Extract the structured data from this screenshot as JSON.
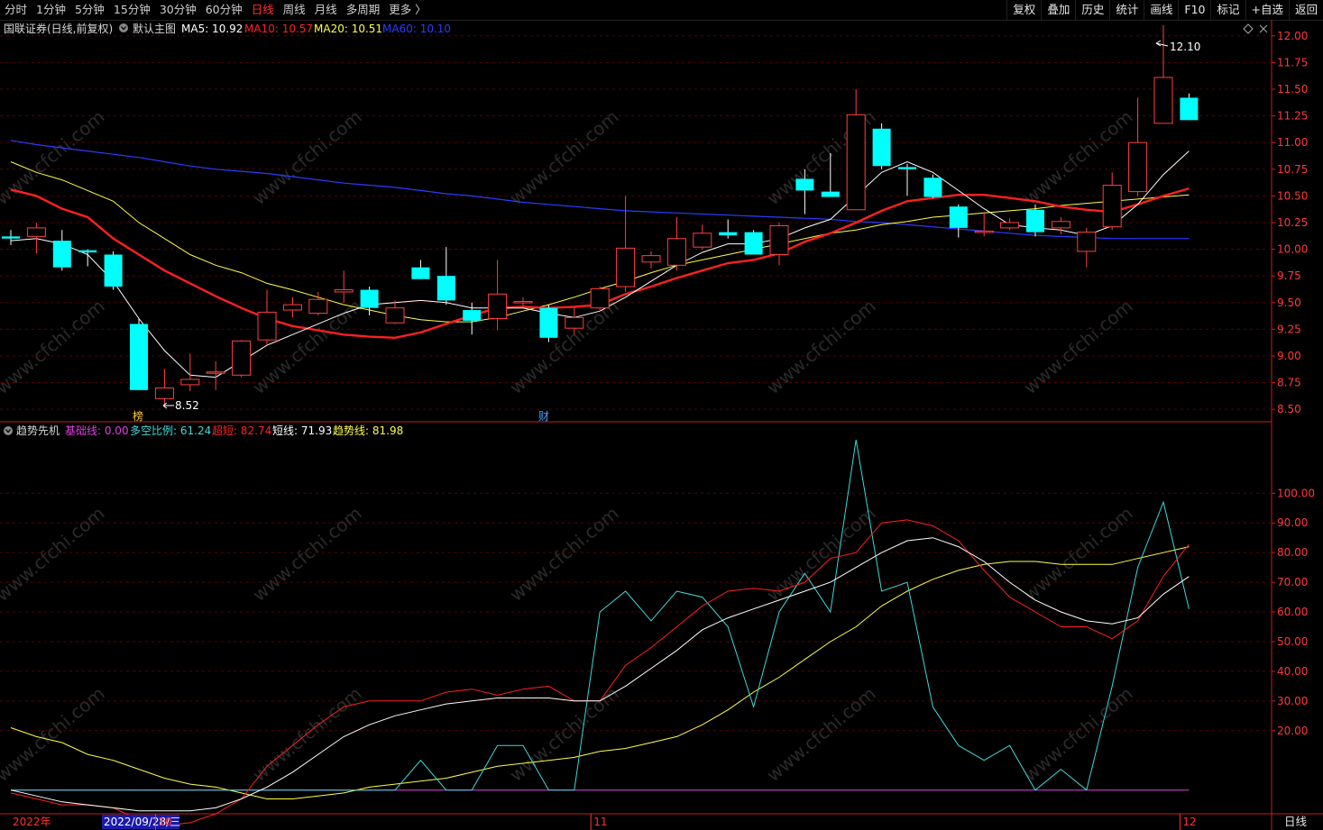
{
  "toolbar": {
    "periods": [
      "分时",
      "1分钟",
      "5分钟",
      "15分钟",
      "30分钟",
      "60分钟",
      "日线",
      "周线",
      "月线",
      "多周期",
      "更多 〉"
    ],
    "active_period": "日线",
    "actions": [
      "复权",
      "叠加",
      "历史",
      "统计",
      "画线",
      "F10",
      "标记",
      "+自选",
      "返回"
    ]
  },
  "main_legend": {
    "title": "国联证券(日线,前复权)",
    "indicator": "默认主图",
    "ma": [
      {
        "label": "MA5: 10.92",
        "color": "#ffffff"
      },
      {
        "label": "MA10: 10.57",
        "color": "#ff2020"
      },
      {
        "label": "MA20: 10.51",
        "color": "#ffff44"
      },
      {
        "label": "MA60: 10.10",
        "color": "#2a3cff"
      }
    ]
  },
  "sub_legend": {
    "title": "趋势先机",
    "items": [
      {
        "label": "基础线: 0.00",
        "color": "#e040e0"
      },
      {
        "label": "多空比例: 61.24",
        "color": "#40d8d8"
      },
      {
        "label": "超短: 82.74",
        "color": "#ff2020"
      },
      {
        "label": "短线: 71.93",
        "color": "#ffffff"
      },
      {
        "label": "趋势线: 81.98",
        "color": "#ffff44"
      }
    ]
  },
  "markers": {
    "high": "12.10",
    "low": "8.52",
    "bang": "榜",
    "cai": "财"
  },
  "watermark": "www.cfchi.com",
  "bottom_axis": {
    "year_label": "2022年",
    "cursor_date": "2022/09/28/三",
    "month_labels": [
      {
        "label": "10",
        "i": 6
      },
      {
        "label": "11",
        "i": 23
      },
      {
        "label": "12",
        "i": 46
      }
    ],
    "period_button": "日线"
  },
  "colors": {
    "up": "#ff4040",
    "down": "#00ffff",
    "grid": "#5a0000",
    "axis": "#c02020"
  },
  "chart_data": [
    {
      "type": "candlestick",
      "ylim": [
        8.4,
        12.15
      ],
      "y_ticks": [
        "12.00",
        "11.75",
        "11.50",
        "11.25",
        "11.00",
        "10.75",
        "10.50",
        "10.25",
        "10.00",
        "9.75",
        "9.50",
        "9.25",
        "9.00",
        "8.75",
        "8.50"
      ],
      "candles": [
        {
          "o": 10.12,
          "h": 10.18,
          "l": 10.04,
          "c": 10.1
        },
        {
          "o": 10.12,
          "h": 10.25,
          "l": 9.96,
          "c": 10.2
        },
        {
          "o": 10.08,
          "h": 10.18,
          "l": 9.8,
          "c": 9.83
        },
        {
          "o": 9.99,
          "h": 10.0,
          "l": 9.84,
          "c": 9.97
        },
        {
          "o": 9.95,
          "h": 9.98,
          "l": 9.62,
          "c": 9.65
        },
        {
          "o": 9.3,
          "h": 9.35,
          "l": 8.68,
          "c": 8.68
        },
        {
          "o": 8.6,
          "h": 8.88,
          "l": 8.52,
          "c": 8.7
        },
        {
          "o": 8.73,
          "h": 9.02,
          "l": 8.67,
          "c": 8.78
        },
        {
          "o": 8.85,
          "h": 8.95,
          "l": 8.68,
          "c": 8.85
        },
        {
          "o": 8.82,
          "h": 9.15,
          "l": 8.8,
          "c": 9.14
        },
        {
          "o": 9.15,
          "h": 9.62,
          "l": 9.1,
          "c": 9.41
        },
        {
          "o": 9.43,
          "h": 9.55,
          "l": 9.36,
          "c": 9.48
        },
        {
          "o": 9.4,
          "h": 9.6,
          "l": 9.38,
          "c": 9.53
        },
        {
          "o": 9.6,
          "h": 9.8,
          "l": 9.5,
          "c": 9.62
        },
        {
          "o": 9.62,
          "h": 9.65,
          "l": 9.38,
          "c": 9.45
        },
        {
          "o": 9.31,
          "h": 9.52,
          "l": 9.3,
          "c": 9.45
        },
        {
          "o": 9.83,
          "h": 9.9,
          "l": 9.72,
          "c": 9.72
        },
        {
          "o": 9.75,
          "h": 10.02,
          "l": 9.48,
          "c": 9.52
        },
        {
          "o": 9.43,
          "h": 9.5,
          "l": 9.2,
          "c": 9.33
        },
        {
          "o": 9.35,
          "h": 9.9,
          "l": 9.24,
          "c": 9.58
        },
        {
          "o": 9.5,
          "h": 9.55,
          "l": 9.46,
          "c": 9.51
        },
        {
          "o": 9.45,
          "h": 9.48,
          "l": 9.13,
          "c": 9.17
        },
        {
          "o": 9.26,
          "h": 9.45,
          "l": 9.2,
          "c": 9.36
        },
        {
          "o": 9.45,
          "h": 9.65,
          "l": 9.42,
          "c": 9.63
        },
        {
          "o": 9.65,
          "h": 10.5,
          "l": 9.6,
          "c": 10.01
        },
        {
          "o": 9.88,
          "h": 9.98,
          "l": 9.82,
          "c": 9.94
        },
        {
          "o": 9.85,
          "h": 10.3,
          "l": 9.8,
          "c": 10.1
        },
        {
          "o": 10.02,
          "h": 10.23,
          "l": 10.0,
          "c": 10.15
        },
        {
          "o": 10.16,
          "h": 10.28,
          "l": 10.1,
          "c": 10.13
        },
        {
          "o": 10.16,
          "h": 10.18,
          "l": 9.95,
          "c": 9.95
        },
        {
          "o": 9.95,
          "h": 10.25,
          "l": 9.85,
          "c": 10.22
        },
        {
          "o": 10.66,
          "h": 10.75,
          "l": 10.33,
          "c": 10.55
        },
        {
          "o": 10.54,
          "h": 10.9,
          "l": 10.5,
          "c": 10.49
        },
        {
          "o": 10.37,
          "h": 11.5,
          "l": 10.37,
          "c": 11.26
        },
        {
          "o": 11.13,
          "h": 11.18,
          "l": 10.75,
          "c": 10.78
        },
        {
          "o": 10.77,
          "h": 10.8,
          "l": 10.5,
          "c": 10.75
        },
        {
          "o": 10.67,
          "h": 10.7,
          "l": 10.48,
          "c": 10.49
        },
        {
          "o": 10.4,
          "h": 10.42,
          "l": 10.11,
          "c": 10.2
        },
        {
          "o": 10.17,
          "h": 10.35,
          "l": 10.12,
          "c": 10.17
        },
        {
          "o": 10.2,
          "h": 10.29,
          "l": 10.18,
          "c": 10.25
        },
        {
          "o": 10.37,
          "h": 10.42,
          "l": 10.12,
          "c": 10.16
        },
        {
          "o": 10.2,
          "h": 10.3,
          "l": 10.14,
          "c": 10.26
        },
        {
          "o": 9.98,
          "h": 10.2,
          "l": 9.83,
          "c": 10.16
        },
        {
          "o": 10.21,
          "h": 10.72,
          "l": 10.18,
          "c": 10.6
        },
        {
          "o": 10.54,
          "h": 11.42,
          "l": 10.5,
          "c": 11.0
        },
        {
          "o": 11.18,
          "h": 12.1,
          "l": 11.18,
          "c": 11.61
        },
        {
          "o": 11.42,
          "h": 11.46,
          "l": 11.21,
          "c": 11.21
        }
      ],
      "ma5": [
        10.08,
        10.1,
        10.05,
        9.95,
        9.7,
        9.35,
        9.05,
        8.82,
        8.8,
        8.95,
        9.1,
        9.2,
        9.3,
        9.4,
        9.48,
        9.5,
        9.52,
        9.5,
        9.45,
        9.45,
        9.45,
        9.4,
        9.36,
        9.42,
        9.55,
        9.7,
        9.85,
        9.97,
        10.05,
        10.05,
        10.1,
        10.2,
        10.28,
        10.5,
        10.72,
        10.82,
        10.72,
        10.55,
        10.38,
        10.23,
        10.2,
        10.18,
        10.13,
        10.22,
        10.42,
        10.7,
        10.92
      ],
      "ma10": [
        10.56,
        10.5,
        10.38,
        10.3,
        10.1,
        9.95,
        9.8,
        9.68,
        9.56,
        9.45,
        9.35,
        9.28,
        9.24,
        9.2,
        9.18,
        9.17,
        9.22,
        9.3,
        9.38,
        9.45,
        9.46,
        9.45,
        9.46,
        9.48,
        9.58,
        9.65,
        9.73,
        9.8,
        9.87,
        9.9,
        9.96,
        10.07,
        10.15,
        10.25,
        10.36,
        10.45,
        10.48,
        10.51,
        10.51,
        10.48,
        10.45,
        10.4,
        10.37,
        10.35,
        10.42,
        10.5,
        10.57
      ],
      "ma20": [
        10.82,
        10.72,
        10.65,
        10.55,
        10.45,
        10.25,
        10.1,
        9.95,
        9.85,
        9.78,
        9.68,
        9.62,
        9.55,
        9.48,
        9.43,
        9.38,
        9.34,
        9.32,
        9.32,
        9.36,
        9.42,
        9.48,
        9.55,
        9.63,
        9.7,
        9.78,
        9.85,
        9.9,
        9.95,
        10.0,
        10.05,
        10.1,
        10.15,
        10.18,
        10.23,
        10.26,
        10.3,
        10.32,
        10.34,
        10.36,
        10.38,
        10.41,
        10.43,
        10.45,
        10.47,
        10.49,
        10.51
      ],
      "ma60": [
        11.02,
        10.98,
        10.95,
        10.92,
        10.89,
        10.86,
        10.82,
        10.78,
        10.75,
        10.73,
        10.71,
        10.68,
        10.65,
        10.62,
        10.6,
        10.58,
        10.55,
        10.52,
        10.5,
        10.47,
        10.44,
        10.42,
        10.4,
        10.38,
        10.36,
        10.35,
        10.34,
        10.33,
        10.32,
        10.31,
        10.3,
        10.29,
        10.28,
        10.26,
        10.25,
        10.23,
        10.21,
        10.19,
        10.17,
        10.15,
        10.13,
        10.12,
        10.11,
        10.1,
        10.1,
        10.1,
        10.1
      ]
    },
    {
      "type": "line",
      "ylim": [
        -8,
        118
      ],
      "y_ticks": [
        "100.00",
        "90.00",
        "80.00",
        "70.00",
        "60.00",
        "50.00",
        "40.00",
        "30.00",
        "20.00"
      ],
      "series": [
        {
          "name": "多空比例",
          "color": "#40d8d8",
          "values": [
            0,
            0,
            0,
            0,
            0,
            0,
            0,
            0,
            0,
            0,
            0,
            0,
            0,
            0,
            0,
            0,
            10,
            0,
            0,
            15,
            15,
            0,
            0,
            60,
            67,
            57,
            67,
            65,
            55,
            28,
            60,
            73,
            60,
            118,
            67,
            70,
            28,
            15,
            10,
            15,
            0,
            7,
            0,
            35,
            75,
            97,
            61
          ]
        },
        {
          "name": "超短",
          "color": "#ff2020",
          "values": [
            -1,
            -3,
            -5,
            -5,
            -6,
            -10,
            -12,
            -11,
            -8,
            -3,
            8,
            15,
            22,
            28,
            30,
            30,
            30,
            33,
            34,
            32,
            34,
            35,
            30,
            30,
            42,
            48,
            55,
            62,
            67,
            68,
            67,
            70,
            78,
            80,
            90,
            91,
            89,
            84,
            74,
            65,
            60,
            55,
            55,
            51,
            57,
            72,
            82.74
          ]
        },
        {
          "name": "短线",
          "color": "#ffffff",
          "values": [
            0,
            -2,
            -4,
            -5,
            -6,
            -7,
            -7,
            -7,
            -6,
            -3,
            1,
            6,
            12,
            18,
            22,
            25,
            27,
            29,
            30,
            31,
            31,
            31,
            30,
            30,
            35,
            41,
            47,
            54,
            58,
            61,
            64,
            67,
            70,
            75,
            80,
            84,
            85,
            82,
            77,
            70,
            64,
            60,
            57,
            56,
            58,
            66,
            71.93
          ]
        },
        {
          "name": "趋势线",
          "color": "#ffff44",
          "values": [
            21,
            18,
            16,
            12,
            10,
            7,
            4,
            2,
            1,
            -1,
            -3,
            -3,
            -2,
            -1,
            1,
            2,
            3,
            4,
            6,
            8,
            9,
            10,
            11,
            13,
            14,
            16,
            18,
            22,
            27,
            33,
            38,
            44,
            50,
            55,
            62,
            67,
            71,
            74,
            76,
            77,
            77,
            76,
            76,
            76,
            78,
            80,
            81.98
          ]
        },
        {
          "name": "基础线",
          "color": "#e040e0",
          "values": [
            0,
            0,
            0,
            0,
            0,
            0,
            0,
            0,
            0,
            0,
            0,
            0,
            0,
            0,
            0,
            0,
            0,
            0,
            0,
            0,
            0,
            0,
            0,
            0,
            0,
            0,
            0,
            0,
            0,
            0,
            0,
            0,
            0,
            0,
            0,
            0,
            0,
            0,
            0,
            0,
            0,
            0,
            0,
            0,
            0,
            0,
            0
          ]
        }
      ]
    }
  ]
}
